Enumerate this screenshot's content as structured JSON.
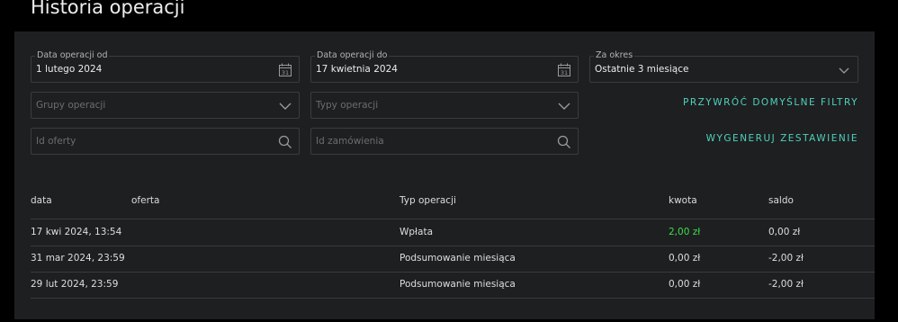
{
  "page": {
    "title": "Historia operacji"
  },
  "filters": {
    "date_from": {
      "label": "Data operacji od",
      "value": "1 lutego 2024",
      "icon": "calendar-icon",
      "icon_day": "31"
    },
    "date_to": {
      "label": "Data operacji do",
      "value": "17 kwietnia 2024",
      "icon": "calendar-icon",
      "icon_day": "31"
    },
    "period": {
      "label": "Za okres",
      "value": "Ostatnie 3 miesiące",
      "icon": "chevron-down-icon"
    },
    "groups": {
      "placeholder": "Grupy operacji",
      "icon": "chevron-down-icon"
    },
    "types": {
      "placeholder": "Typy operacji",
      "icon": "chevron-down-icon"
    },
    "offer_id": {
      "placeholder": "Id oferty",
      "icon": "search-icon"
    },
    "order_id": {
      "placeholder": "Id zamówienia",
      "icon": "search-icon"
    },
    "reset_label": "PRZYWRÓĆ DOMYŚLNE FILTRY",
    "generate_label": "WYGENERUJ ZESTAWIENIE"
  },
  "table": {
    "headers": {
      "date": "data",
      "offer": "oferta",
      "type": "Typ operacji",
      "amount": "kwota",
      "balance": "saldo"
    },
    "rows": [
      {
        "date": "17 kwi 2024, 13:54",
        "offer": "",
        "type": "Wpłata",
        "amount": "2,00 zł",
        "balance": "0,00 zł",
        "amount_positive": true
      },
      {
        "date": "31 mar 2024, 23:59",
        "offer": "",
        "type": "Podsumowanie miesiąca",
        "amount": "0,00 zł",
        "balance": "-2,00 zł",
        "amount_positive": false
      },
      {
        "date": "29 lut 2024, 23:59",
        "offer": "",
        "type": "Podsumowanie miesiąca",
        "amount": "0,00 zł",
        "balance": "-2,00 zł",
        "amount_positive": false
      }
    ]
  },
  "colors": {
    "accent": "#4fd1bd",
    "positive": "#3ddc4c",
    "panel": "#1e1f21",
    "background": "#000000"
  }
}
